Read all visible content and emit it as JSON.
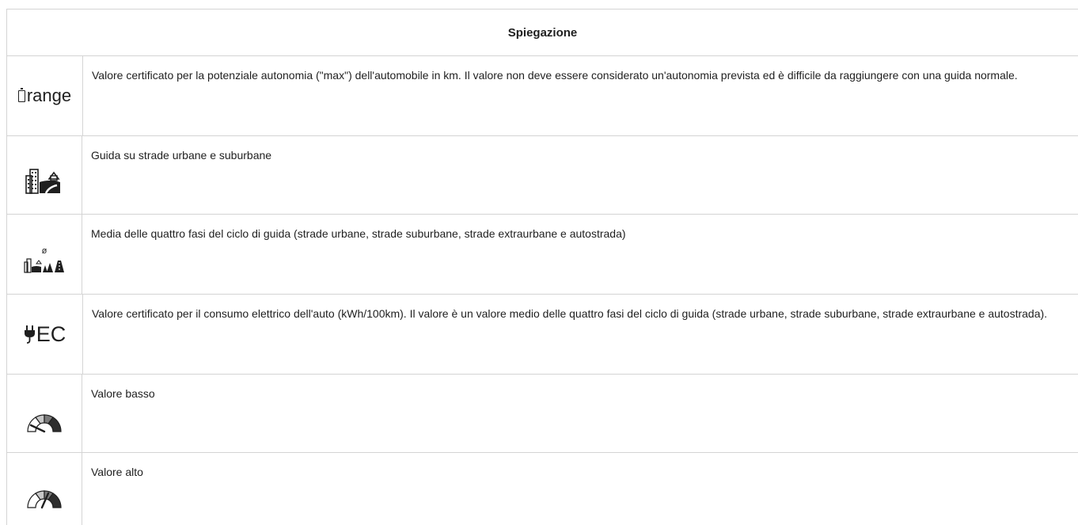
{
  "header": {
    "title": "Spiegazione"
  },
  "rows": [
    {
      "icon": "range-battery-icon",
      "icon_label": "range",
      "text": "Valore certificato per la potenziale autonomia (\"max\") dell'automobile in km. Il valore non deve essere considerato un'autonomia prevista ed è difficile da raggiungere con una guida normale."
    },
    {
      "icon": "city-suburban-road-icon",
      "text": "Guida su strade urbane e suburbane"
    },
    {
      "icon": "average-four-phases-icon",
      "icon_label": "ø",
      "text": "Media delle quattro fasi del ciclo di guida (strade urbane, strade suburbane, strade extraurbane e autostrada)"
    },
    {
      "icon": "electric-plug-ec-icon",
      "icon_label": "EC",
      "text": "Valore certificato per il consumo elettrico dell'auto (kWh/100km). Il valore è un valore medio delle quattro fasi del ciclo di guida (strade urbane, strade suburbane, strade extraurbane e autostrada)."
    },
    {
      "icon": "gauge-low-icon",
      "gauge_level": "low",
      "text": "Valore basso"
    },
    {
      "icon": "gauge-high-icon",
      "gauge_level": "high",
      "text": "Valore alto"
    }
  ],
  "colors": {
    "border": "#d4d4d4",
    "text": "#1f1f1f",
    "gauge_light": "#c8c8c8",
    "gauge_mid": "#7a7a7a",
    "gauge_dark": "#2e2e2e"
  }
}
